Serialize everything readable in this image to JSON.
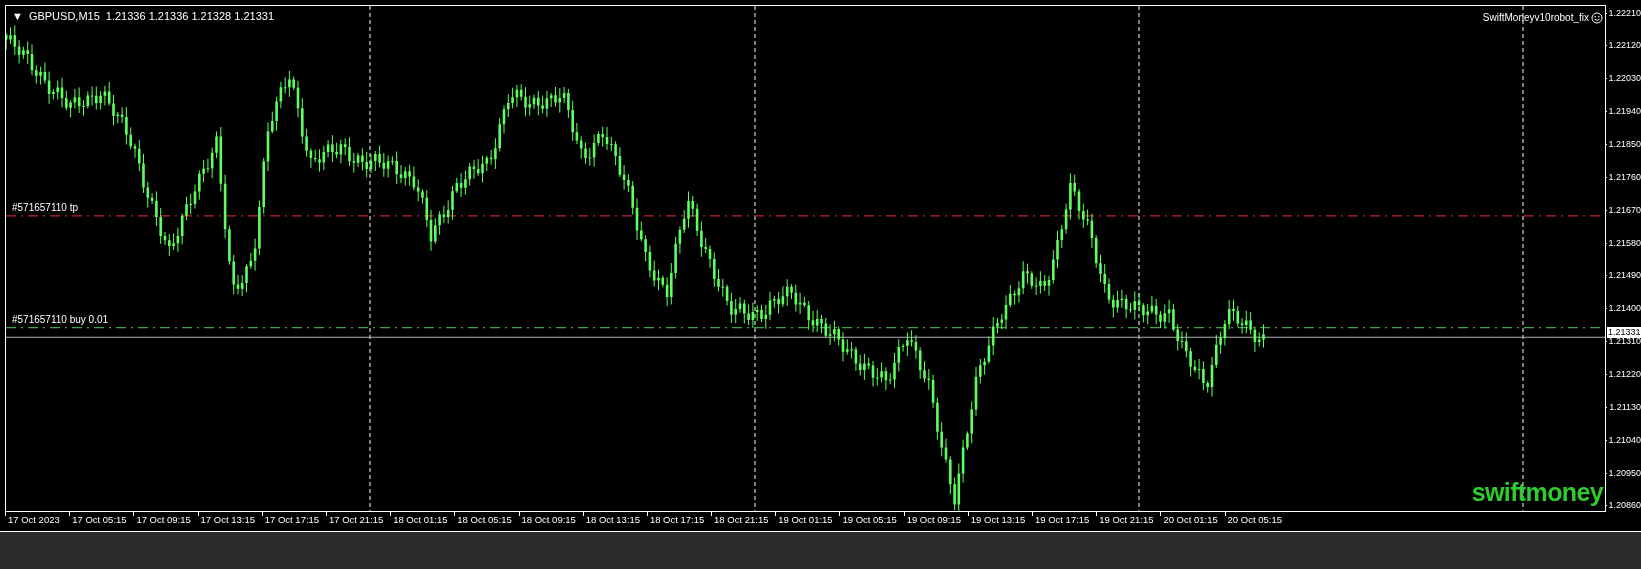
{
  "chart": {
    "menu_glyph": "▼",
    "symbol": "GBPUSD,M15",
    "quotes": "1.21336 1.21336 1.21328 1.21331",
    "expert": "SwiftMoneyv10robot_fix",
    "brand": "swiftmoney",
    "order_lines": [
      {
        "kind": "tp",
        "label": "#571657110 tp"
      },
      {
        "kind": "buy",
        "label": "#571657110 buy 0.01"
      }
    ],
    "current_price": "1.21331",
    "price_axis": [
      "1.22210",
      "1.22120",
      "1.22030",
      "1.21940",
      "1.21850",
      "1.21760",
      "1.21670",
      "1.21580",
      "1.21490",
      "1.21400",
      "1.21310",
      "1.21220",
      "1.21130",
      "1.21040",
      "1.20950",
      "1.20860"
    ],
    "time_axis": [
      "17 Oct 2023",
      "17 Oct 05:15",
      "17 Oct 09:15",
      "17 Oct 13:15",
      "17 Oct 17:15",
      "17 Oct 21:15",
      "18 Oct 01:15",
      "18 Oct 05:15",
      "18 Oct 09:15",
      "18 Oct 13:15",
      "18 Oct 17:15",
      "18 Oct 21:15",
      "19 Oct 01:15",
      "19 Oct 05:15",
      "19 Oct 09:15",
      "19 Oct 13:15",
      "19 Oct 17:15",
      "19 Oct 21:15",
      "20 Oct 01:15",
      "20 Oct 05:15"
    ]
  }
}
